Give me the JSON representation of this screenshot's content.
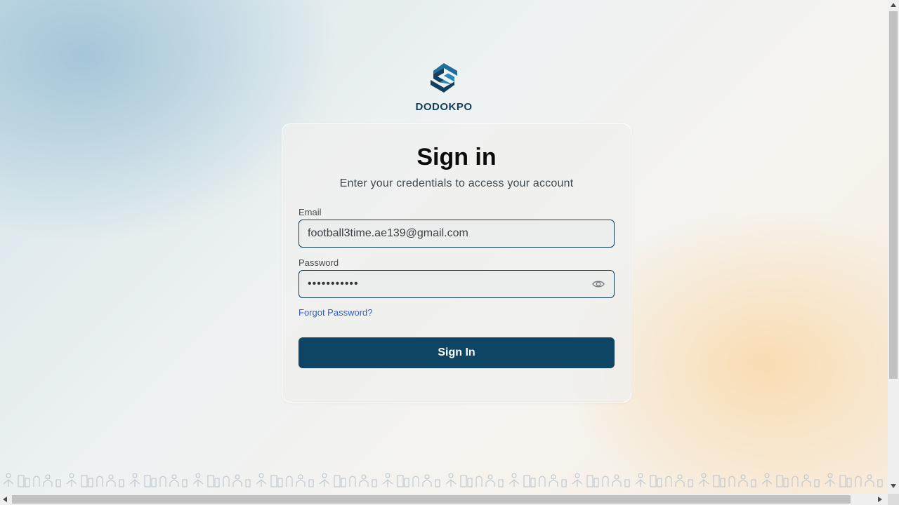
{
  "brand": {
    "name": "DODOKPO",
    "logo_icon": "hexagon-s-logo-icon",
    "color": "#123f5c"
  },
  "card": {
    "title": "Sign in",
    "subtitle": "Enter your credentials to access your account"
  },
  "form": {
    "email": {
      "label": "Email",
      "value": "football3time.ae139@gmail.com"
    },
    "password": {
      "label": "Password",
      "masked_value": "•••••••••••",
      "toggle_icon": "eye-icon"
    },
    "forgot_password_label": "Forgot Password?",
    "submit_label": "Sign In"
  },
  "colors": {
    "primary": "#0e4565",
    "link": "#2f5fcf",
    "field_border": "#123f5c"
  }
}
